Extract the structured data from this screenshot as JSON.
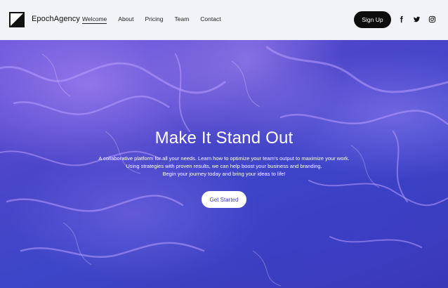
{
  "header": {
    "brand": "EpochAgency",
    "nav": [
      {
        "label": "Welcome"
      },
      {
        "label": "About"
      },
      {
        "label": "Pricing"
      },
      {
        "label": "Team"
      },
      {
        "label": "Contact"
      }
    ],
    "signup_label": "Sign Up",
    "social_icons": [
      "facebook-icon",
      "twitter-icon",
      "instagram-icon"
    ]
  },
  "hero": {
    "title": "Make It Stand Out",
    "lines": [
      "A collaborative platform for all your needs. Learn how to optimize your team's output to maximize your work.",
      "Using strategies with proven results, we can help boost your business and branding.",
      "Begin your journey today and bring your ideas to life!"
    ],
    "cta_label": "Get Started"
  },
  "colors": {
    "header_bg": "#f2f3f8",
    "button_dark": "#0d0d0d",
    "hero_purple": "#4b45c9",
    "cta_text": "#3b3fc2"
  }
}
